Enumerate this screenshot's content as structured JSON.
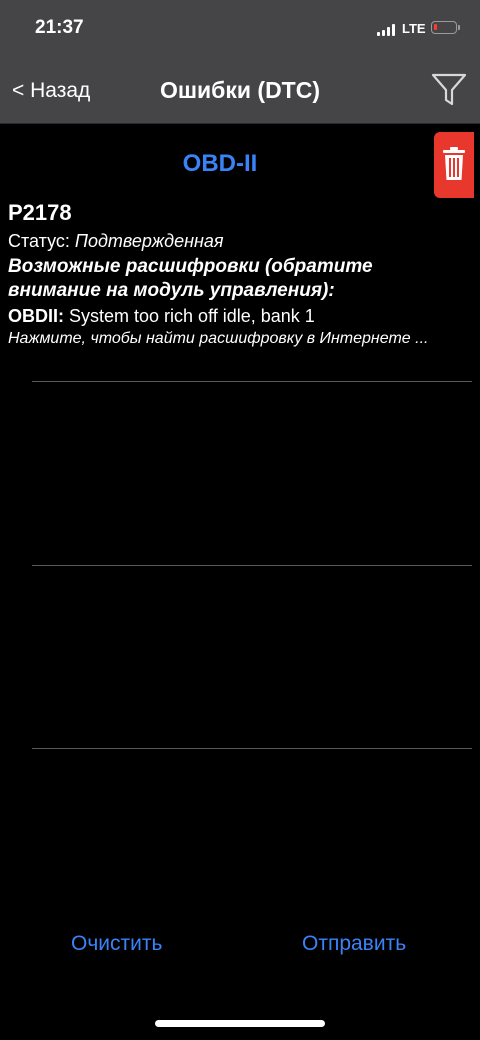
{
  "status_bar": {
    "time": "21:37",
    "network": "LTE",
    "icons": [
      "signal-icon",
      "battery-icon"
    ]
  },
  "nav": {
    "back_label": "< Назад",
    "title": "Ошибки (DTC)",
    "filter_icon": "filter-icon"
  },
  "toolbar": {
    "delete_icon": "trash-icon"
  },
  "section": {
    "header": "OBD-II"
  },
  "dtc_list": [
    {
      "code": "P2178",
      "status_label": "Статус:",
      "status_value": "Подтвержденная",
      "possible_label": "Возможные расшифровки (обратите внимание на модуль управления):",
      "obd_label": "OBDII:",
      "obd_description": "System too rich off idle, bank 1",
      "hint": "Нажмите, чтобы найти расшифровку в Интернете ..."
    }
  ],
  "actions": {
    "clear_label": "Очистить",
    "send_label": "Отправить"
  },
  "colors": {
    "accent": "#3a82f7",
    "danger": "#e8372c",
    "bar": "#454547"
  }
}
